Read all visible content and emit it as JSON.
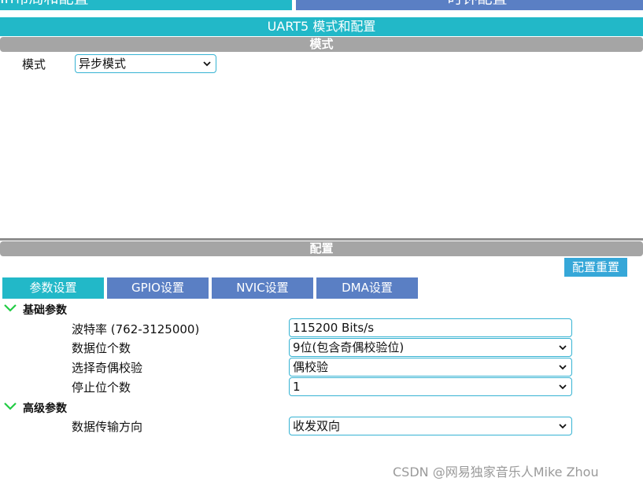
{
  "top_tabs": {
    "left_label": "In布局和配置",
    "right_label": "时钟配置"
  },
  "header": {
    "title": "UART5 模式和配置"
  },
  "mode_section": {
    "title": "模式",
    "mode_label": "模式",
    "mode_value": "异步模式"
  },
  "config_section": {
    "title": "配置",
    "reset_button": "配置重置",
    "tabs": [
      {
        "label": "参数设置"
      },
      {
        "label": "GPIO设置"
      },
      {
        "label": "NVIC设置"
      },
      {
        "label": "DMA设置"
      }
    ]
  },
  "params": {
    "basic_title": "基础参数",
    "baud": {
      "label": "波特率 (762-3125000)",
      "value": "115200 Bits/s"
    },
    "word_length": {
      "label": "数据位个数",
      "value": "9位(包含奇偶校验位)"
    },
    "parity": {
      "label": "选择奇偶校验",
      "value": "偶校验"
    },
    "stop_bits": {
      "label": "停止位个数",
      "value": "1"
    },
    "advanced_title": "高级参数",
    "direction": {
      "label": "数据传输方向",
      "value": "收发双向"
    }
  },
  "watermark": "CSDN @网易独家音乐人Mike Zhou",
  "colors": {
    "teal": "#22b8c8",
    "blue_tab": "#5a7fc4",
    "gray_bar": "#a5a5a5",
    "field_border": "#36b3d3",
    "expand_arrow": "#22cc44"
  }
}
